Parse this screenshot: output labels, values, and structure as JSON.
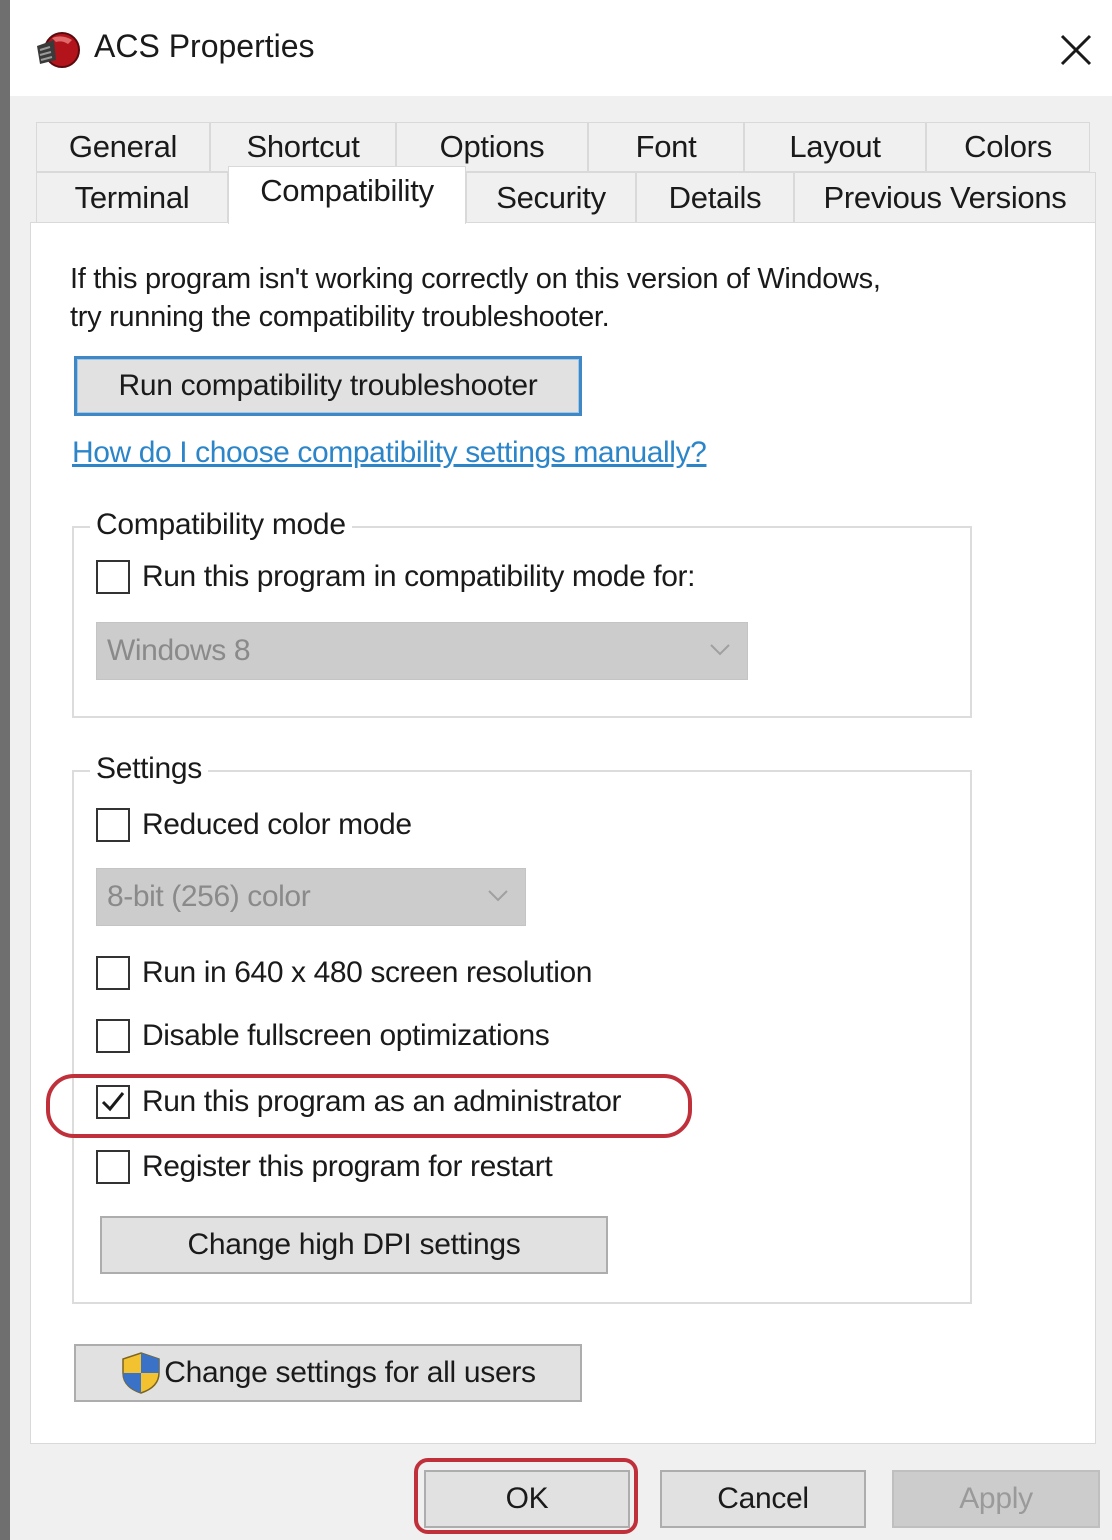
{
  "window": {
    "title": "ACS Properties",
    "app_icon": "acs-app-icon",
    "close_icon": "close-icon"
  },
  "tabs": {
    "row1": [
      "General",
      "Shortcut",
      "Options",
      "Font",
      "Layout",
      "Colors"
    ],
    "row2": [
      "Terminal",
      "Compatibility",
      "Security",
      "Details",
      "Previous Versions"
    ],
    "active": "Compatibility"
  },
  "compatibility": {
    "intro_line1": "If this program isn't working correctly on this version of Windows,",
    "intro_line2": "try running the compatibility troubleshooter.",
    "troubleshooter_button": "Run compatibility troubleshooter",
    "help_link": "How do I choose compatibility settings manually?",
    "mode_group": {
      "legend": "Compatibility mode",
      "checkbox_label": "Run this program in compatibility mode for:",
      "checked": false,
      "select_value": "Windows 8"
    },
    "settings_group": {
      "legend": "Settings",
      "reduced_color": {
        "label": "Reduced color mode",
        "checked": false
      },
      "color_select_value": "8-bit (256) color",
      "res_640": {
        "label": "Run in 640 x 480 screen resolution",
        "checked": false
      },
      "disable_fullscreen": {
        "label": "Disable fullscreen optimizations",
        "checked": false
      },
      "run_as_admin": {
        "label": "Run this program as an administrator",
        "checked": true
      },
      "register_restart": {
        "label": "Register this program for restart",
        "checked": false
      },
      "dpi_button": "Change high DPI settings"
    },
    "all_users_button": "Change settings for all users",
    "shield_icon": "uac-shield-icon"
  },
  "footer": {
    "ok": "OK",
    "cancel": "Cancel",
    "apply": "Apply",
    "apply_disabled": true
  },
  "annotation_color": "#c0303a",
  "link_color": "#2b85c8",
  "focus_color": "#3f88c5"
}
